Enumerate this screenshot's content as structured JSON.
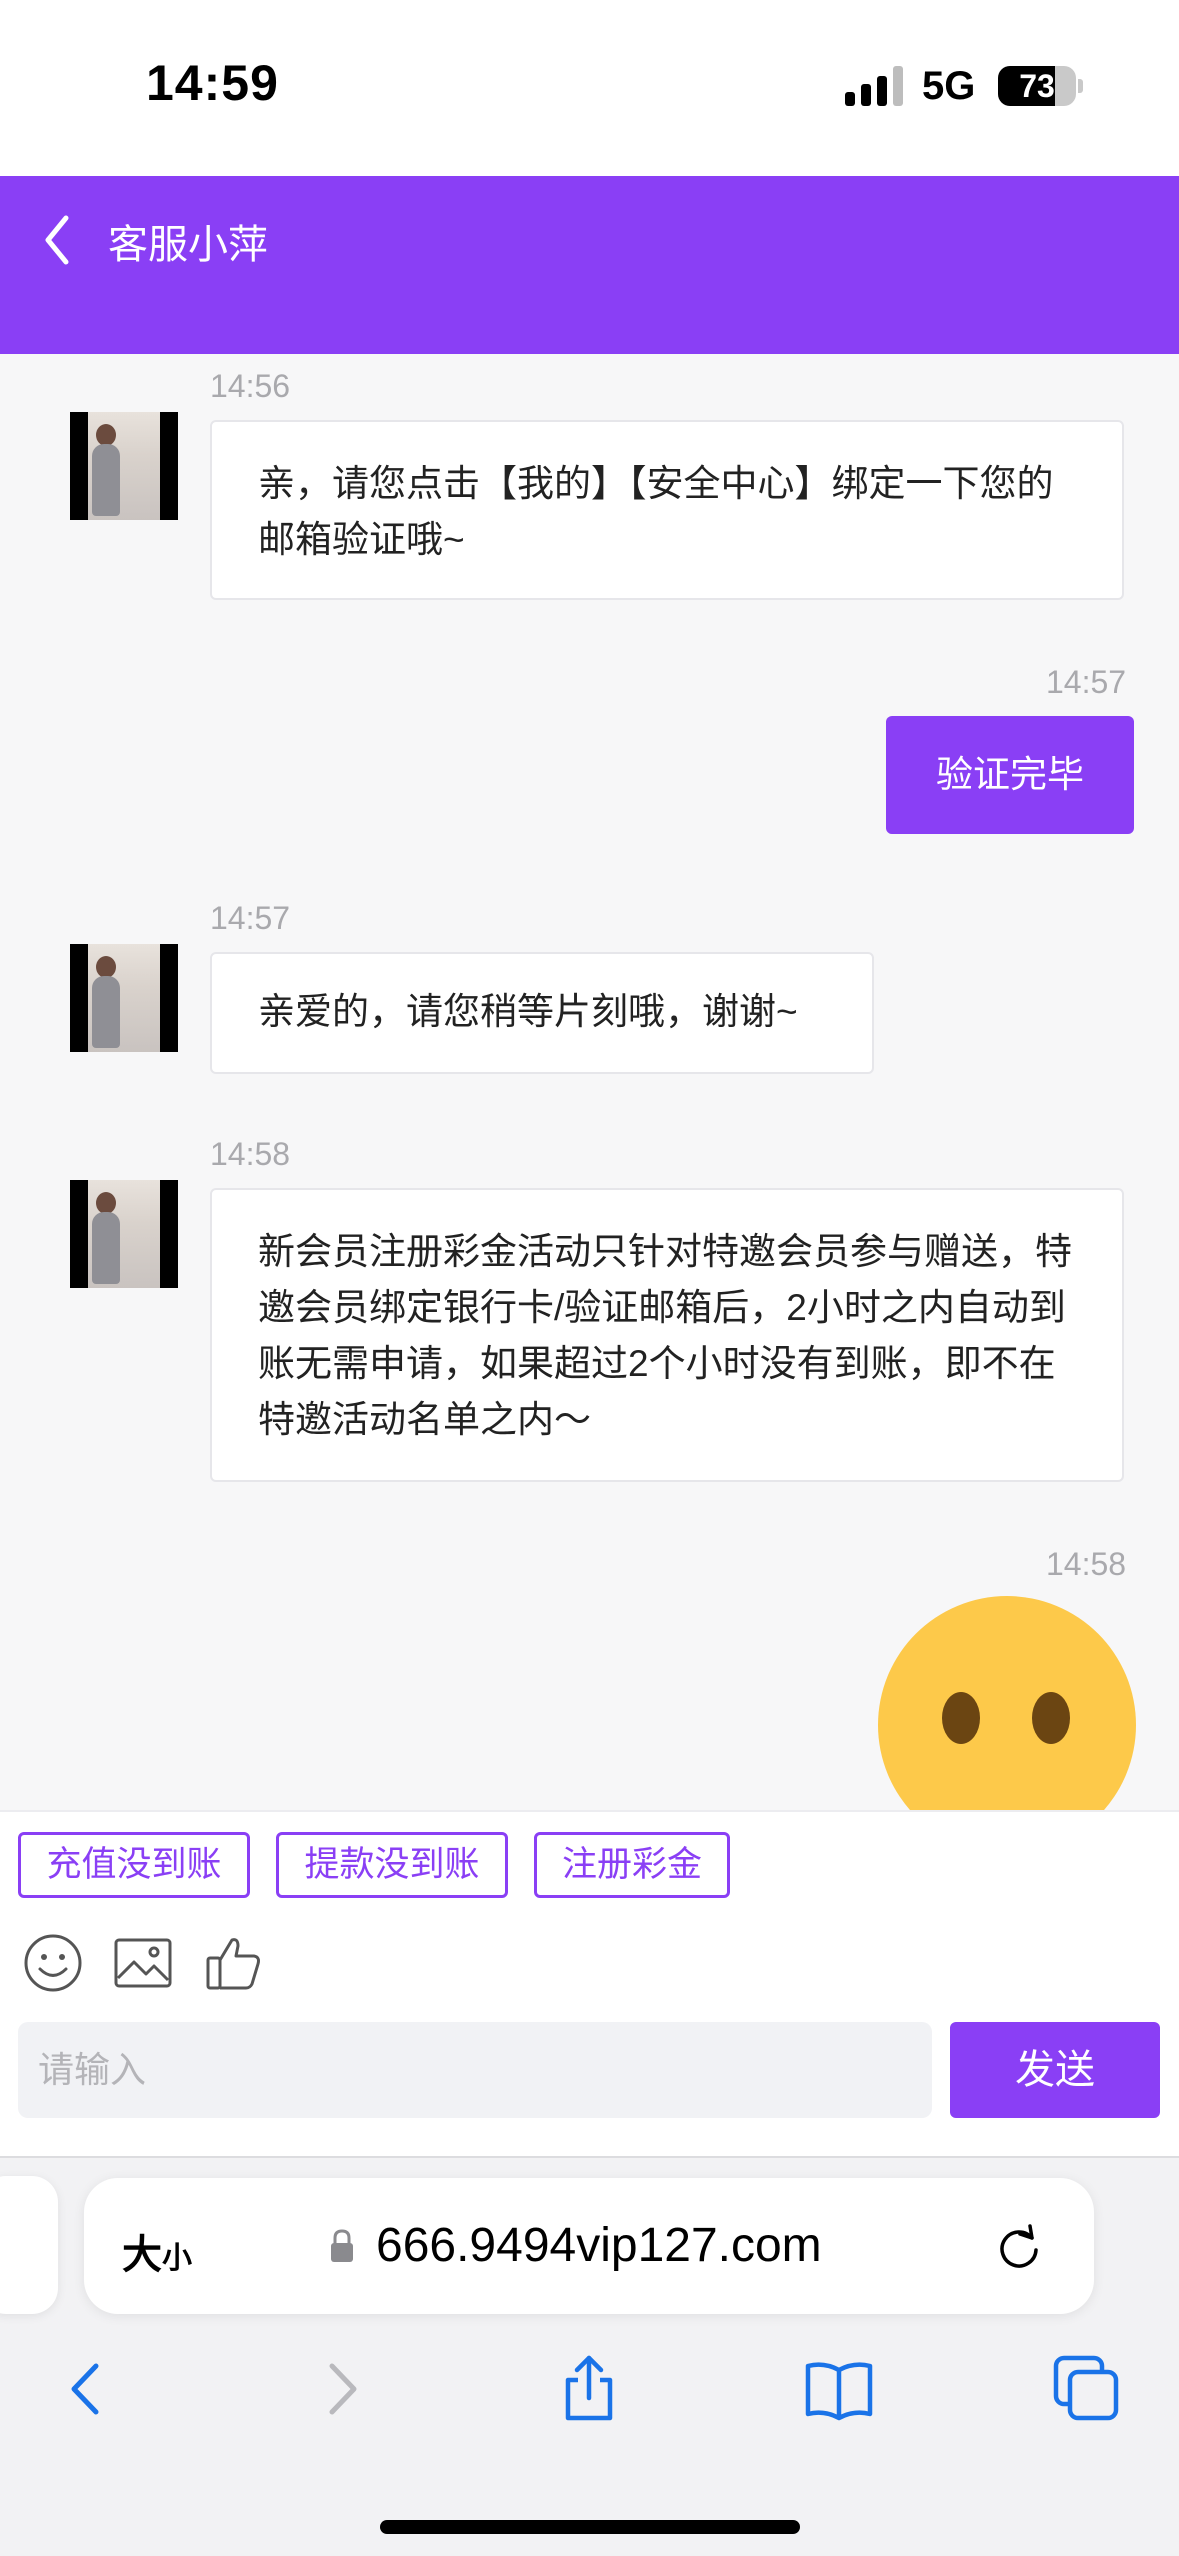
{
  "status_bar": {
    "time": "14:59",
    "network": "5G",
    "battery": "73",
    "battery_level": 0.73
  },
  "header": {
    "title": "客服小萍",
    "back_icon": "chevron-left-icon"
  },
  "messages": [
    {
      "time": "14:56",
      "text": "亲，请您点击【我的】【安全中心】绑定一下您的邮箱验证哦~",
      "direction": "in"
    },
    {
      "time": "14:57",
      "text": "验证完毕",
      "direction": "out"
    },
    {
      "time": "14:57",
      "text": "亲爱的，请您稍等片刻哦，谢谢~",
      "direction": "in"
    },
    {
      "time": "14:58",
      "text": "新会员注册彩金活动只针对特邀会员参与赠送，特邀会员绑定银行卡/验证邮箱后，2小时之内自动到账无需申请，如果超过2个小时没有到账，即不在特邀活动名单之内～",
      "direction": "in"
    },
    {
      "time": "14:58",
      "emoji": "neutral-face-emoji",
      "direction": "out"
    }
  ],
  "quick_replies": [
    "充值没到账",
    "提款没到账",
    "注册彩金"
  ],
  "toolbar": {
    "icons": [
      "smiley-icon",
      "image-icon",
      "thumbs-up-icon"
    ]
  },
  "composer": {
    "placeholder": "请输入",
    "value": "",
    "send_label": "发送"
  },
  "browser": {
    "text_size_label": "大",
    "text_size_small": "小",
    "url": "666.9494vip127.com",
    "icons": [
      "back-icon",
      "forward-icon",
      "share-icon",
      "bookmarks-icon",
      "tabs-icon"
    ]
  },
  "colors": {
    "accent": "#8a3ff5",
    "background": "#f7f7f8",
    "bubble_in": "#ffffff",
    "emoji": "#fdc94a"
  }
}
